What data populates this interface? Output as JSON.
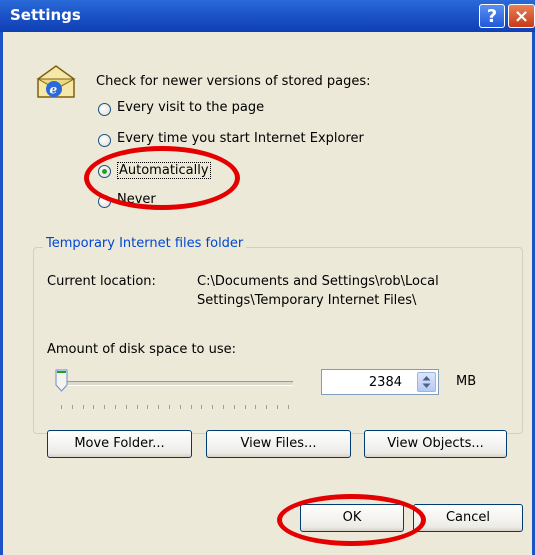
{
  "window": {
    "title": "Settings"
  },
  "titlebar": {
    "help_glyph": "?",
    "close_glyph": "×"
  },
  "check_group": {
    "prompt": "Check for newer versions of stored pages:",
    "options": [
      {
        "label": "Every visit to the page",
        "checked": false
      },
      {
        "label": "Every time you start Internet Explorer",
        "checked": false
      },
      {
        "label": "Automatically",
        "checked": true
      },
      {
        "label": "Never",
        "checked": false
      }
    ]
  },
  "temp_folder": {
    "group_title": "Temporary Internet files folder",
    "location_label": "Current location:",
    "location_line1": "C:\\Documents and Settings\\rob\\Local",
    "location_line2": "Settings\\Temporary Internet Files\\",
    "disk_label": "Amount of disk space to use:",
    "disk_value": "2384",
    "disk_unit": "MB",
    "slider_level_fraction": 0.0,
    "buttons": [
      "Move Folder...",
      "View Files...",
      "View Objects..."
    ]
  },
  "dialog_buttons": {
    "ok": "OK",
    "cancel": "Cancel"
  },
  "icons": [
    "ie-settings-icon",
    "help-icon",
    "close-icon",
    "spinner-icon",
    "slider-thumb-icon"
  ],
  "colors": {
    "titlebar": "#1c54c8",
    "annotation": "#e40000",
    "group_title": "#0046d5"
  }
}
